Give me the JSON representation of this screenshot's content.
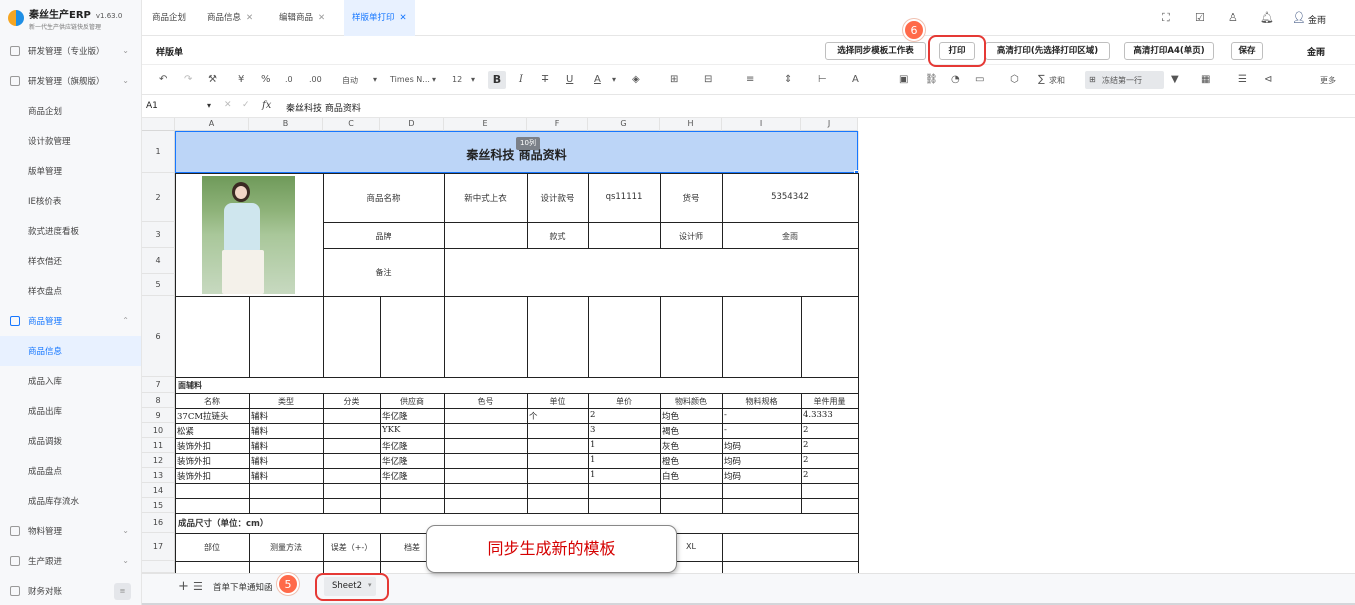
{
  "app": {
    "title": "秦丝生产ERP",
    "version": "v1.63.0",
    "subtitle": "新一代生产供应链快反管理"
  },
  "sidebar": {
    "groups": [
      {
        "label": "研发管理（专业版）",
        "icon": "box-icon"
      },
      {
        "label": "研发管理（旗舰版）",
        "icon": "box-icon"
      }
    ],
    "items1": [
      "商品企划",
      "设计款管理",
      "版单管理",
      "IE核价表",
      "款式进度看板",
      "样衣借还",
      "样衣盘点"
    ],
    "goods": "商品管理",
    "items2": [
      "商品信息",
      "成品入库",
      "成品出库",
      "成品调拨",
      "成品盘点",
      "成品库存流水"
    ],
    "groups2": [
      "物料管理",
      "生产跟进",
      "财务对账"
    ],
    "collapse": "≡"
  },
  "tabs": [
    {
      "label": "商品企划"
    },
    {
      "label": "商品信息"
    },
    {
      "label": "编辑商品"
    },
    {
      "label": "样版单打印"
    }
  ],
  "user": "金雨",
  "ribbon": {
    "title": "样版单",
    "sync": "选择同步模板工作表",
    "print": "打印",
    "hd": "高清打印(先选择打印区域)",
    "a4": "高清打印A4(单页)",
    "save": "保存",
    "user": "金雨"
  },
  "toolbar": {
    "font_auto": "自动",
    "font_name": "Times N...",
    "font_size": "12",
    "sum": "求和",
    "freeze": "冻结第一行",
    "more": "更多"
  },
  "formula": {
    "ref": "A1",
    "fx": "fx",
    "content": "秦丝科技 商品资料"
  },
  "cols": [
    "A",
    "B",
    "C",
    "D",
    "E",
    "F",
    "G",
    "H",
    "I",
    "J"
  ],
  "rows": [
    "1",
    "2",
    "3",
    "4",
    "5",
    "6",
    "7",
    "8",
    "9",
    "10",
    "11",
    "12",
    "13",
    "14",
    "15",
    "16",
    "17"
  ],
  "sheet": {
    "title": "秦丝科技 商品资料",
    "col_tip": "10列",
    "name_label": "商品名称",
    "name": "新中式上衣",
    "design_label": "设计款号",
    "design": "qs11111",
    "no_label": "货号",
    "no": "5354342",
    "brand_label": "品牌",
    "style_label": "款式",
    "designer_label": "设计师",
    "designer": "金雨",
    "remark_label": "备注",
    "material_title": "面辅料",
    "material_headers": [
      "名称",
      "类型",
      "分类",
      "供应商",
      "色号",
      "单位",
      "单价",
      "物料颜色",
      "物料规格",
      "单件用量"
    ],
    "materials": [
      [
        "37CM拉链头",
        "辅料",
        "",
        "华亿隆",
        "",
        "个",
        "2",
        "均色",
        "-",
        "4.3333"
      ],
      [
        "松紧",
        "辅料",
        "",
        "YKK",
        "",
        "",
        "3",
        "褐色",
        "-",
        "2"
      ],
      [
        "装饰外扣",
        "辅料",
        "",
        "华亿隆",
        "",
        "",
        "1",
        "灰色",
        "均码",
        "2"
      ],
      [
        "装饰外扣",
        "辅料",
        "",
        "华亿隆",
        "",
        "",
        "1",
        "橙色",
        "均码",
        "2"
      ],
      [
        "装饰外扣",
        "辅料",
        "",
        "华亿隆",
        "",
        "",
        "1",
        "白色",
        "均码",
        "2"
      ]
    ],
    "size_title": "成品尺寸（单位：cm）",
    "size_headers": [
      "部位",
      "测量方法",
      "误差（+-）",
      "档差",
      "",
      "",
      "",
      "XL"
    ]
  },
  "sheet_tabs": [
    "首单下单通知函",
    "Sheet2"
  ],
  "annotations": {
    "step5": "5",
    "step6": "6",
    "callout": "同步生成新的模板"
  },
  "colors": {
    "accent": "#1677ff",
    "header_fill": "#bcd5f7",
    "red": "#e53935",
    "badge": "#ff6a4a"
  }
}
